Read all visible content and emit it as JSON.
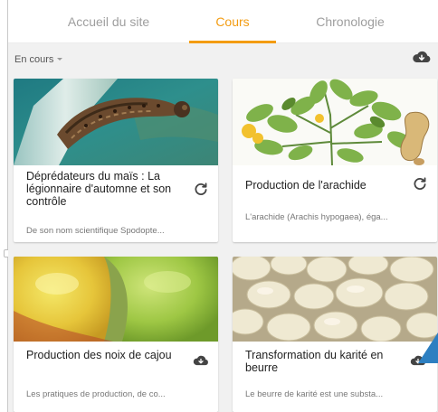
{
  "tabs": [
    {
      "label": "Accueil du site",
      "active": false
    },
    {
      "label": "Cours",
      "active": true
    },
    {
      "label": "Chronologie",
      "active": false
    }
  ],
  "filter": {
    "label": "En cours"
  },
  "colors": {
    "accent": "#f39c12",
    "text": "#222222",
    "muted": "#777777",
    "tab_inactive": "#9e9e9e"
  },
  "icons": {
    "download_all": "cloud-download-icon",
    "refresh": "refresh-icon",
    "download": "cloud-download-icon"
  },
  "courses": [
    {
      "title": "Déprédateurs du maïs : La légionnaire d'automne et son contrôle",
      "description": "De son nom scientifique Spodopte...",
      "action": "refresh"
    },
    {
      "title": "Production de l'arachide",
      "description": "L'arachide (Arachis hypogaea), éga...",
      "action": "refresh"
    },
    {
      "title": "Production des noix de cajou",
      "description": "Les pratiques de production, de co...",
      "action": "download"
    },
    {
      "title": "Transformation du karité en beurre",
      "description": "Le beurre de karité est une substa...",
      "action": "download"
    }
  ]
}
